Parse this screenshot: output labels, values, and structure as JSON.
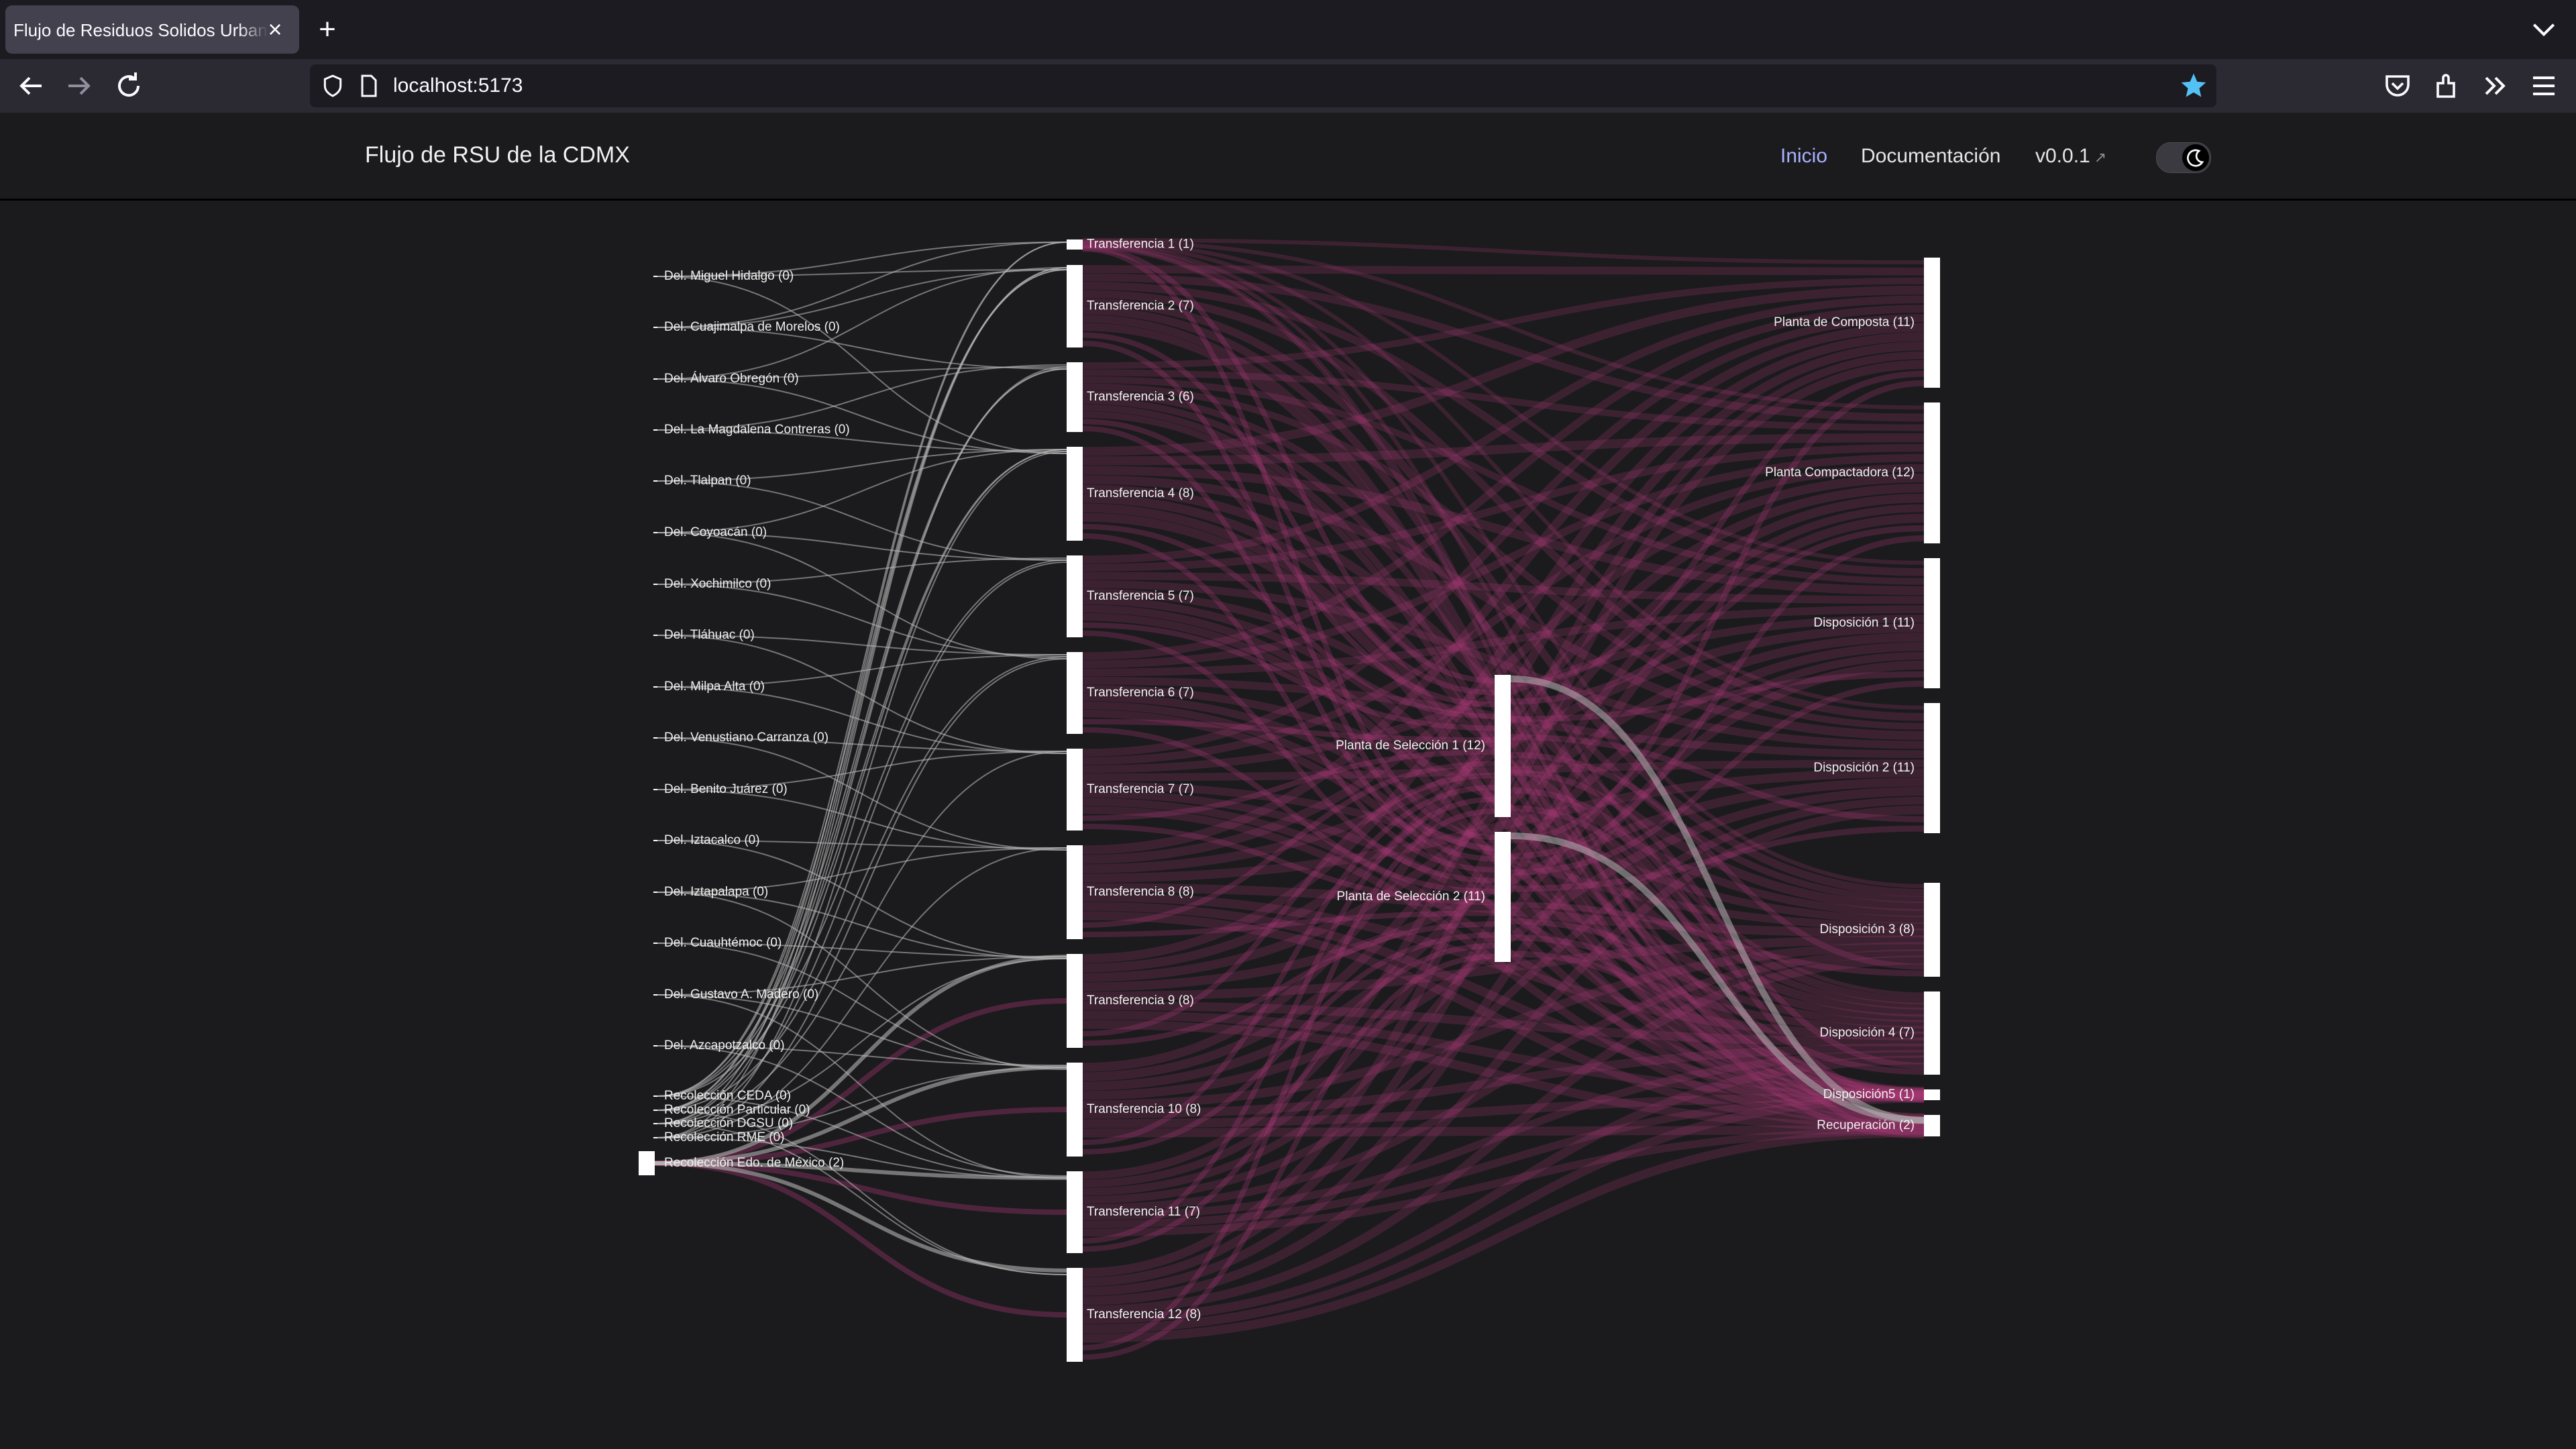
{
  "browser": {
    "tab_title": "Flujo de Residuos Solidos Urbanos de la CDMX",
    "url": "localhost:5173"
  },
  "header": {
    "title": "Flujo de RSU de la CDMX",
    "nav": {
      "home": "Inicio",
      "docs": "Documentación",
      "version": "v0.0.1",
      "version_arrow": "↗"
    },
    "theme_toggle": "dark"
  },
  "colors": {
    "accent": "#a8b1ff",
    "flow_pink": "#b23a7c",
    "flow_grey": "#b4b4b4",
    "node": "#ffffff"
  },
  "sankey": {
    "sources": [
      {
        "name": "Del. Miguel Hidalgo (0)",
        "targets": [
          1,
          2,
          4
        ]
      },
      {
        "name": "Del. Cuajimalpa de Morelos (0)",
        "targets": [
          1,
          2,
          3
        ]
      },
      {
        "name": "Del. Álvaro Obregón (0)",
        "targets": [
          2,
          3,
          4
        ]
      },
      {
        "name": "Del. La Magdalena Contreras (0)",
        "targets": [
          3,
          4
        ]
      },
      {
        "name": "Del. Tlalpan (0)",
        "targets": [
          4,
          5
        ]
      },
      {
        "name": "Del. Coyoacán (0)",
        "targets": [
          4,
          5,
          6
        ]
      },
      {
        "name": "Del. Xochimilco (0)",
        "targets": [
          5,
          6
        ]
      },
      {
        "name": "Del. Tláhuac (0)",
        "targets": [
          6,
          7
        ]
      },
      {
        "name": "Del. Milpa Alta (0)",
        "targets": [
          6,
          7
        ]
      },
      {
        "name": "Del. Venustiano Carranza (0)",
        "targets": [
          7,
          8
        ]
      },
      {
        "name": "Del. Benito Juárez (0)",
        "targets": [
          7,
          8
        ]
      },
      {
        "name": "Del. Iztacalco (0)",
        "targets": [
          8,
          9
        ]
      },
      {
        "name": "Del. Iztapalapa (0)",
        "targets": [
          8,
          9,
          10
        ]
      },
      {
        "name": "Del. Cuauhtémoc (0)",
        "targets": [
          9,
          10
        ]
      },
      {
        "name": "Del. Gustavo A. Madero (0)",
        "targets": [
          9,
          10,
          11
        ]
      },
      {
        "name": "Del. Azcapotzalco (0)",
        "targets": [
          10,
          11
        ]
      },
      {
        "name": "Recolección CEDA (0)",
        "targets": [
          1,
          2,
          3,
          4,
          5,
          11
        ]
      },
      {
        "name": "Recolección Particular (0)",
        "targets": [
          1,
          2,
          3,
          4,
          6,
          12
        ]
      },
      {
        "name": "Recolección DGSU (0)",
        "targets": [
          2,
          3,
          5,
          7,
          9,
          12
        ]
      },
      {
        "name": "Recolección RME (0)",
        "targets": [
          2,
          4,
          6,
          8,
          10,
          11
        ]
      },
      {
        "name": "Recolección Edo. de México (2)",
        "targets": [
          9,
          10,
          11,
          12
        ]
      }
    ],
    "transfers": [
      {
        "name": "Transferencia 1 (1)"
      },
      {
        "name": "Transferencia 2 (7)"
      },
      {
        "name": "Transferencia 3 (6)"
      },
      {
        "name": "Transferencia 4 (8)"
      },
      {
        "name": "Transferencia 5 (7)"
      },
      {
        "name": "Transferencia 6 (7)"
      },
      {
        "name": "Transferencia 7 (7)"
      },
      {
        "name": "Transferencia 8 (8)"
      },
      {
        "name": "Transferencia 9 (8)"
      },
      {
        "name": "Transferencia 10 (8)"
      },
      {
        "name": "Transferencia 11 (7)"
      },
      {
        "name": "Transferencia 12 (8)"
      }
    ],
    "plants": [
      {
        "name": "Planta de Selección 1 (12)"
      },
      {
        "name": "Planta de Selección 2 (11)"
      }
    ],
    "destinations": [
      {
        "name": "Planta de Composta (11)"
      },
      {
        "name": "Planta Compactadora (12)"
      },
      {
        "name": "Disposición 1 (11)"
      },
      {
        "name": "Disposición 2 (11)"
      },
      {
        "name": "Disposición 3 (8)"
      },
      {
        "name": "Disposición 4 (7)"
      },
      {
        "name": "Disposición5 (1)"
      },
      {
        "name": "Recuperación (2)"
      }
    ]
  }
}
